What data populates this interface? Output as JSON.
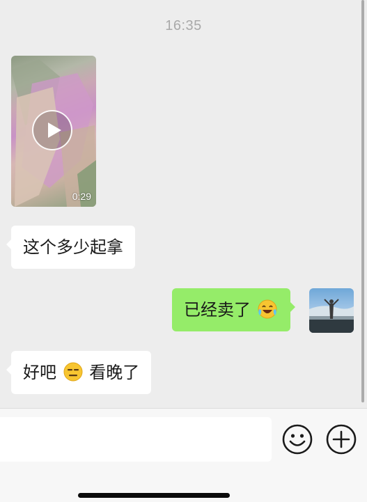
{
  "chat": {
    "timestamp": "16:35",
    "video": {
      "duration": "0:29"
    },
    "messages": [
      {
        "side": "left",
        "text": "这个多少起拿"
      },
      {
        "side": "right",
        "text": "已经卖了",
        "emoji": "laughing-crying-emoji"
      },
      {
        "side": "left",
        "text_before": "好吧",
        "emoji": "expressionless-emoji",
        "text_after": "看晚了"
      }
    ]
  },
  "input_bar": {
    "value": "",
    "emoji_button_icon": "smiley-face-icon",
    "more_button_icon": "plus-circle-icon"
  }
}
